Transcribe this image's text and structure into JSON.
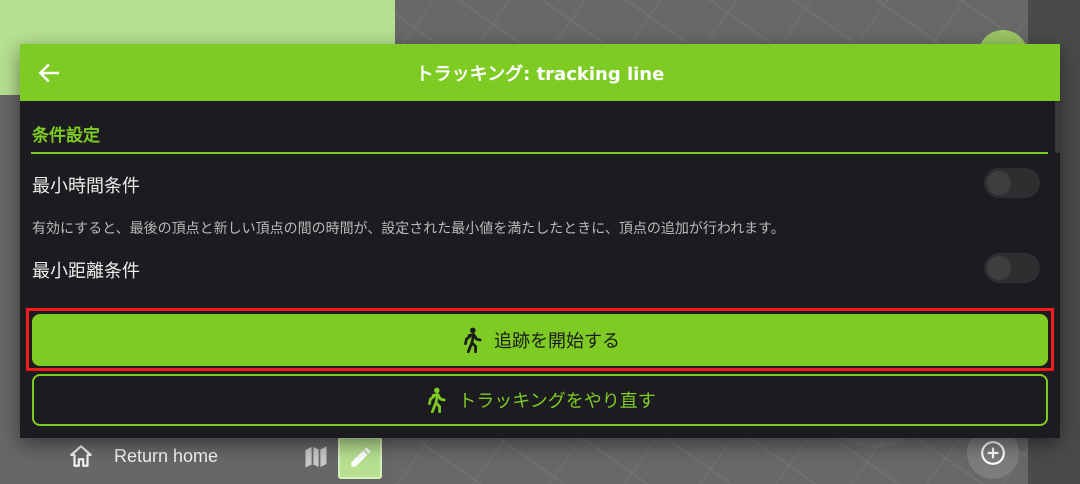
{
  "background": {
    "bottom_bar": {
      "return_home_label": "Return home"
    }
  },
  "dialog": {
    "title": "トラッキング: tracking line",
    "section_title": "条件設定",
    "settings": [
      {
        "label": "最小時間条件",
        "description": "有効にすると、最後の頂点と新しい頂点の間の時間が、設定された最小値を満たしたときに、頂点の追加が行われます。",
        "enabled": false
      },
      {
        "label": "最小距離条件",
        "enabled": false
      }
    ],
    "start_button_label": "追跡を開始する",
    "reset_button_label": "トラッキングをやり直す"
  },
  "icons": {
    "back": "arrow-left-icon",
    "walk": "walk-icon",
    "home": "home-icon",
    "map": "map-icon",
    "edit": "pencil-icon",
    "add": "plus-circle-icon"
  },
  "colors": {
    "accent": "#7ecb24",
    "dialog_bg": "#1c1b1f",
    "highlight": "#ef1c1c"
  }
}
